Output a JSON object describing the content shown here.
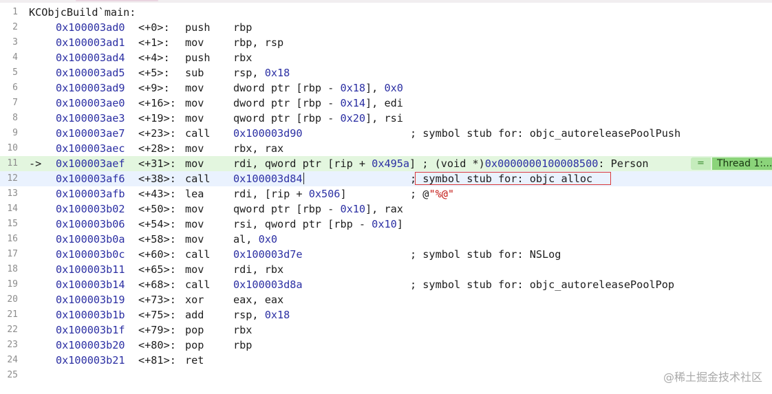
{
  "title": "KCObjcBuild`main:",
  "lines": [
    {
      "n": "1"
    },
    {
      "n": "2",
      "addr": "0x100003ad0",
      "off": "<+0>:",
      "op": "push",
      "args": [
        {
          "t": "rbp"
        }
      ]
    },
    {
      "n": "3",
      "addr": "0x100003ad1",
      "off": "<+1>:",
      "op": "mov",
      "args": [
        {
          "t": "rbp, rsp"
        }
      ]
    },
    {
      "n": "4",
      "addr": "0x100003ad4",
      "off": "<+4>:",
      "op": "push",
      "args": [
        {
          "t": "rbx"
        }
      ]
    },
    {
      "n": "5",
      "addr": "0x100003ad5",
      "off": "<+5>:",
      "op": "sub",
      "args": [
        {
          "t": "rsp, "
        },
        {
          "t": "0x18",
          "k": "num"
        }
      ]
    },
    {
      "n": "6",
      "addr": "0x100003ad9",
      "off": "<+9>:",
      "op": "mov",
      "args": [
        {
          "t": "dword ptr [rbp - "
        },
        {
          "t": "0x18",
          "k": "num"
        },
        {
          "t": "], "
        },
        {
          "t": "0x0",
          "k": "num"
        }
      ]
    },
    {
      "n": "7",
      "addr": "0x100003ae0",
      "off": "<+16>:",
      "op": "mov",
      "args": [
        {
          "t": "dword ptr [rbp - "
        },
        {
          "t": "0x14",
          "k": "num"
        },
        {
          "t": "], edi"
        }
      ]
    },
    {
      "n": "8",
      "addr": "0x100003ae3",
      "off": "<+19>:",
      "op": "mov",
      "args": [
        {
          "t": "qword ptr [rbp - "
        },
        {
          "t": "0x20",
          "k": "num"
        },
        {
          "t": "], rsi"
        }
      ]
    },
    {
      "n": "9",
      "addr": "0x100003ae7",
      "off": "<+23>:",
      "op": "call",
      "args": [
        {
          "t": "0x100003d90",
          "k": "num"
        }
      ],
      "cmt": [
        {
          "t": "; symbol stub for: objc_autoreleasePoolPush"
        }
      ]
    },
    {
      "n": "10",
      "addr": "0x100003aec",
      "off": "<+28>:",
      "op": "mov",
      "args": [
        {
          "t": "rbx, rax"
        }
      ]
    },
    {
      "n": "11",
      "arrow": "->",
      "hl": "green",
      "addr": "0x100003aef",
      "off": "<+31>:",
      "op": "mov",
      "args": [
        {
          "t": "rdi, qword ptr [rip + "
        },
        {
          "t": "0x495a",
          "k": "num"
        },
        {
          "t": "] ; (void *)"
        },
        {
          "t": "0x0000000100008500",
          "k": "num"
        },
        {
          "t": ": Person"
        }
      ],
      "badge_eq": "=",
      "thread": "Thread 1:..."
    },
    {
      "n": "12",
      "hl": "blue",
      "addr": "0x100003af6",
      "off": "<+38>:",
      "op": "call",
      "args": [
        {
          "t": "0x100003d84",
          "k": "num"
        }
      ],
      "cursor": true,
      "cmt": [
        {
          "t": "; symbol stub for: objc_alloc"
        }
      ],
      "boxed": true
    },
    {
      "n": "13",
      "addr": "0x100003afb",
      "off": "<+43>:",
      "op": "lea",
      "args": [
        {
          "t": "rdi, [rip + "
        },
        {
          "t": "0x506",
          "k": "num"
        },
        {
          "t": "]"
        }
      ],
      "cmt": [
        {
          "t": "; @"
        },
        {
          "t": "\"%@\"",
          "k": "str"
        }
      ]
    },
    {
      "n": "14",
      "addr": "0x100003b02",
      "off": "<+50>:",
      "op": "mov",
      "args": [
        {
          "t": "qword ptr [rbp - "
        },
        {
          "t": "0x10",
          "k": "num"
        },
        {
          "t": "], rax"
        }
      ]
    },
    {
      "n": "15",
      "addr": "0x100003b06",
      "off": "<+54>:",
      "op": "mov",
      "args": [
        {
          "t": "rsi, qword ptr [rbp - "
        },
        {
          "t": "0x10",
          "k": "num"
        },
        {
          "t": "]"
        }
      ]
    },
    {
      "n": "16",
      "addr": "0x100003b0a",
      "off": "<+58>:",
      "op": "mov",
      "args": [
        {
          "t": "al, "
        },
        {
          "t": "0x0",
          "k": "num"
        }
      ]
    },
    {
      "n": "17",
      "addr": "0x100003b0c",
      "off": "<+60>:",
      "op": "call",
      "args": [
        {
          "t": "0x100003d7e",
          "k": "num"
        }
      ],
      "cmt": [
        {
          "t": "; symbol stub for: NSLog"
        }
      ]
    },
    {
      "n": "18",
      "addr": "0x100003b11",
      "off": "<+65>:",
      "op": "mov",
      "args": [
        {
          "t": "rdi, rbx"
        }
      ]
    },
    {
      "n": "19",
      "addr": "0x100003b14",
      "off": "<+68>:",
      "op": "call",
      "args": [
        {
          "t": "0x100003d8a",
          "k": "num"
        }
      ],
      "cmt": [
        {
          "t": "; symbol stub for: objc_autoreleasePoolPop"
        }
      ]
    },
    {
      "n": "20",
      "addr": "0x100003b19",
      "off": "<+73>:",
      "op": "xor",
      "args": [
        {
          "t": "eax, eax"
        }
      ]
    },
    {
      "n": "21",
      "addr": "0x100003b1b",
      "off": "<+75>:",
      "op": "add",
      "args": [
        {
          "t": "rsp, "
        },
        {
          "t": "0x18",
          "k": "num"
        }
      ]
    },
    {
      "n": "22",
      "addr": "0x100003b1f",
      "off": "<+79>:",
      "op": "pop",
      "args": [
        {
          "t": "rbx"
        }
      ]
    },
    {
      "n": "23",
      "addr": "0x100003b20",
      "off": "<+80>:",
      "op": "pop",
      "args": [
        {
          "t": "rbp"
        }
      ]
    },
    {
      "n": "24",
      "addr": "0x100003b21",
      "off": "<+81>:",
      "op": "ret",
      "args": []
    },
    {
      "n": "25"
    }
  ],
  "watermark": "@稀土掘金技术社区",
  "colors": {
    "address": "#2b2fa3",
    "string": "#c41a16",
    "current_line": "#e3f6df",
    "selected_line": "#eaf2fe",
    "annotation_box": "#d9383a",
    "thread_badge": "#8bd47a"
  }
}
